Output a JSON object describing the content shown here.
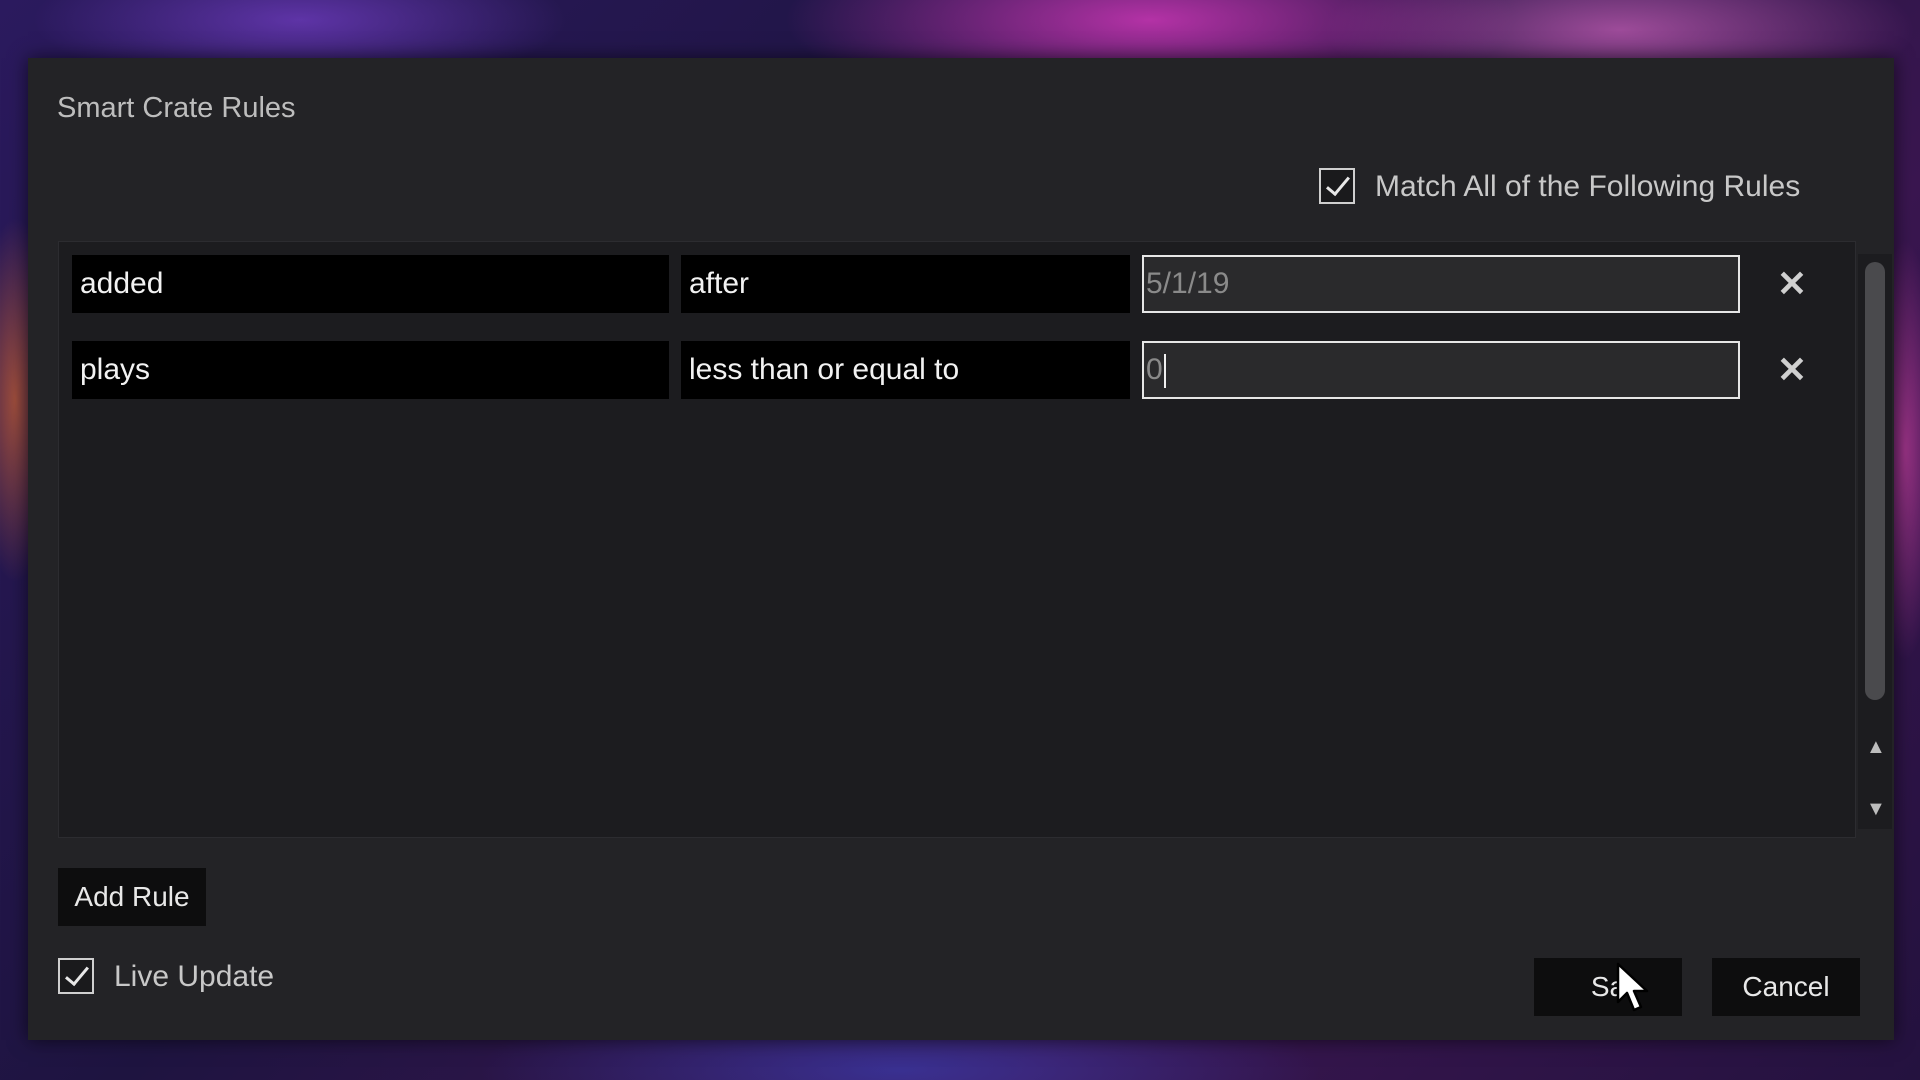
{
  "dialog": {
    "title": "Smart Crate Rules",
    "match_all": {
      "label": "Match All of the Following Rules",
      "checked": true
    }
  },
  "rules": [
    {
      "field": "added",
      "operator": "after",
      "value": "5/1/19"
    },
    {
      "field": "plays",
      "operator": "less than or equal to",
      "value": "0"
    }
  ],
  "icons": {
    "remove": "close-icon",
    "scroll_up": "triangle-up-icon",
    "scroll_down": "triangle-down-icon",
    "checkmark": "checkmark-icon",
    "cursor": "mouse-pointer-icon"
  },
  "footer": {
    "add_rule_label": "Add Rule",
    "live_update": {
      "label": "Live Update",
      "checked": true
    },
    "save_label": "Sa",
    "cancel_label": "Cancel"
  },
  "colors": {
    "dialog_bg": "#232326",
    "panel_bg": "#1c1c1f",
    "field_bg": "#000000",
    "input_border": "#e6e6e6"
  }
}
